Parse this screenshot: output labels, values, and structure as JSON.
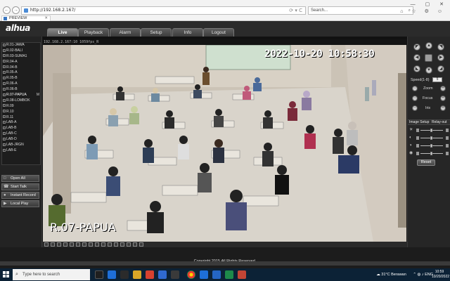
{
  "browser": {
    "url": "http://192.168.2.167/",
    "search_placeholder": "Search...",
    "tab_title": "PREVIEW",
    "back_glyph": "←",
    "forward_glyph": "→",
    "addr_tools": "⟳ ▾ C",
    "window_controls": "— ▢ ✕",
    "toolbar_icons": "⌂ ☆ ⚙ ☺",
    "tab_close": "✕"
  },
  "app": {
    "logo": "alhua",
    "menu": [
      "Live",
      "Playback",
      "Alarm",
      "Setup",
      "Info",
      "Logout"
    ],
    "active_menu": "Live"
  },
  "channels": [
    "R.01-JAWA",
    "R.02-BALI",
    "R.03-SUMA1",
    "R.04-A",
    "R.04-B",
    "R.05-A",
    "R.05-B",
    "R.06-A",
    "R.06-B",
    "R.07-PAPUA",
    "R.08-LOMBOK",
    "R.09",
    "R.10",
    "R.11",
    "LAB-A",
    "LAB-B",
    "LAB-C",
    "LAB-D",
    "LAB-JRGN",
    "LAB-E"
  ],
  "selected_channel_marker": "M",
  "left_buttons": [
    {
      "label": "Open All",
      "icon": "□"
    },
    {
      "label": "Start Talk",
      "icon": "☎"
    },
    {
      "label": "Instant Record",
      "icon": "●"
    },
    {
      "label": "Local Play",
      "icon": "▶"
    }
  ],
  "video": {
    "info_bar": "192.168.2.167:10 1059fps_R",
    "timestamp": "2022-10-20 10:58:30",
    "channel_label": "R.07-PAPUA"
  },
  "ptz": {
    "speed_label": "Speed(1-8)",
    "speed_value": "5",
    "zoom_label": "Zoom",
    "focus_label": "Focus",
    "iris_label": "Iris",
    "arrows": {
      "up": "▲",
      "down": "▼",
      "left": "◀",
      "right": "▶",
      "upleft": "◤",
      "upright": "◥",
      "downleft": "◣",
      "downright": "◢"
    },
    "plus": "+",
    "minus": "−"
  },
  "image_setup": {
    "title": "Image Setup",
    "relay": "Relay-out",
    "reset_label": "Reset",
    "slider_icons": [
      "☀",
      "◐",
      "◑",
      "◉"
    ],
    "slider_levels": [
      0.5,
      0.5,
      0.5,
      0.5
    ]
  },
  "footer": {
    "copyright": "Copyright 2015,All Rights Reserved."
  },
  "taskbar": {
    "search": "Type here to search",
    "weather": "31°C  Berawan",
    "tray_icons": "⌃ ◍ ♪ ENG",
    "time": "10:59",
    "date": "10/20/2022",
    "search_glyph": "⌕",
    "weather_icon": "☁"
  }
}
